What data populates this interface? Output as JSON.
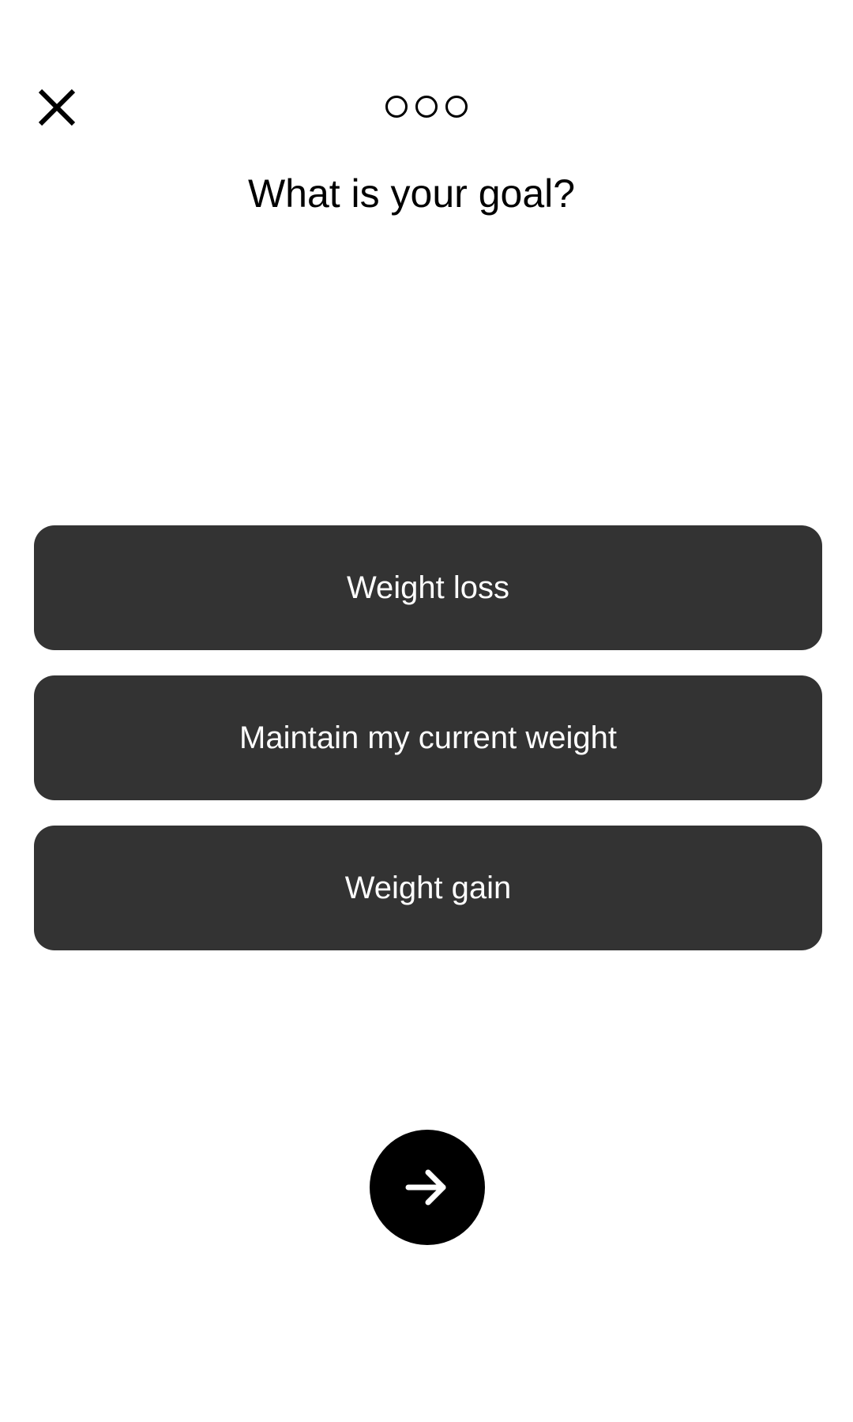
{
  "header": {
    "close_icon": "close-icon",
    "progress_steps": 3
  },
  "question": {
    "title": "What is your goal?"
  },
  "options": [
    {
      "label": "Weight loss"
    },
    {
      "label": "Maintain my current weight"
    },
    {
      "label": "Weight gain"
    }
  ],
  "footer": {
    "next_icon": "arrow-right-icon"
  },
  "colors": {
    "background": "#ffffff",
    "option_background": "#333333",
    "option_text": "#ffffff",
    "next_button": "#000000"
  }
}
